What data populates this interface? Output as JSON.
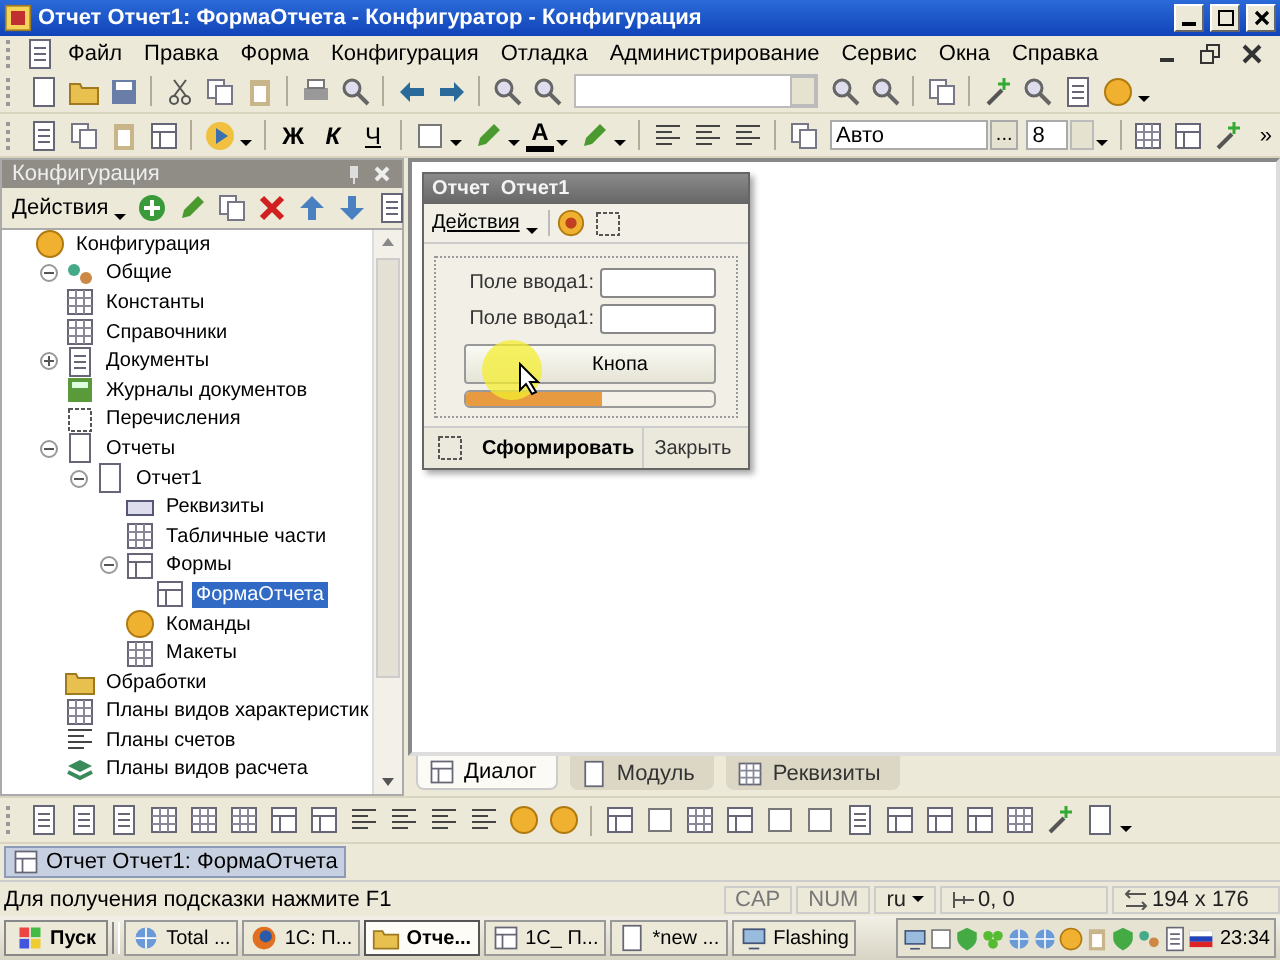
{
  "window": {
    "title": "Отчет Отчет1: ФормаОтчета - Конфигуратор - Конфигурация"
  },
  "menu": [
    "Файл",
    "Правка",
    "Форма",
    "Конфигурация",
    "Отладка",
    "Администрирование",
    "Сервис",
    "Окна",
    "Справка"
  ],
  "format_toolbar": {
    "bold": "Ж",
    "italic": "К",
    "underline": "Ч",
    "font_color": "A",
    "font": "Авто",
    "font_more": "...",
    "size": "8",
    "more": "»"
  },
  "config_panel": {
    "title": "Конфигурация",
    "actions": "Действия",
    "tree": [
      {
        "label": "Конфигурация",
        "selected": false,
        "children": [
          {
            "label": "Общие",
            "selected": false,
            "expanded": true
          },
          {
            "label": "Константы",
            "selected": false
          },
          {
            "label": "Справочники",
            "selected": false
          },
          {
            "label": "Документы",
            "selected": false,
            "expanded": false
          },
          {
            "label": "Журналы документов",
            "selected": false
          },
          {
            "label": "Перечисления",
            "selected": false
          },
          {
            "label": "Отчеты",
            "selected": false,
            "expanded": true,
            "children": [
              {
                "label": "Отчет1",
                "selected": false,
                "expanded": true,
                "children": [
                  {
                    "label": "Реквизиты",
                    "selected": false
                  },
                  {
                    "label": "Табличные части",
                    "selected": false
                  },
                  {
                    "label": "Формы",
                    "selected": false,
                    "expanded": true,
                    "children": [
                      {
                        "label": "ФормаОтчета",
                        "selected": true
                      }
                    ]
                  },
                  {
                    "label": "Команды",
                    "selected": false
                  },
                  {
                    "label": "Макеты",
                    "selected": false
                  }
                ]
              }
            ]
          },
          {
            "label": "Обработки",
            "selected": false
          },
          {
            "label": "Планы видов характеристик",
            "selected": false
          },
          {
            "label": "Планы счетов",
            "selected": false
          },
          {
            "label": "Планы видов расчета",
            "selected": false
          }
        ]
      }
    ]
  },
  "form_preview": {
    "title": "Отчет  Отчет1",
    "actions": "Действия",
    "fields": [
      {
        "label": "Поле ввода1:"
      },
      {
        "label": "Поле ввода1:"
      }
    ],
    "button": "Кнопа",
    "progress": {
      "level": 0.55
    },
    "footer": {
      "primary": "Сформировать",
      "secondary": "Закрыть"
    }
  },
  "editor_tabs": [
    {
      "label": "Диалог",
      "selected": true
    },
    {
      "label": "Модуль",
      "selected": false
    },
    {
      "label": "Реквизиты",
      "selected": false
    }
  ],
  "window_tab": "Отчет Отчет1: ФормаОтчета",
  "status_bar": {
    "hint": "Для получения подсказки нажмите F1",
    "caps": "CAP",
    "num": "NUM",
    "lang": "ru",
    "position": "0, 0",
    "size": "194 x 176"
  },
  "taskbar": {
    "start": "Пуск",
    "items": [
      {
        "label": "Total ...",
        "selected": false
      },
      {
        "label": "1С: П...",
        "selected": false
      },
      {
        "label": "Отче...",
        "selected": true
      },
      {
        "label": "1С_ П...",
        "selected": false
      },
      {
        "label": "*new ...",
        "selected": false
      },
      {
        "label": "Flashing",
        "selected": false
      }
    ],
    "clock": "23:34"
  }
}
